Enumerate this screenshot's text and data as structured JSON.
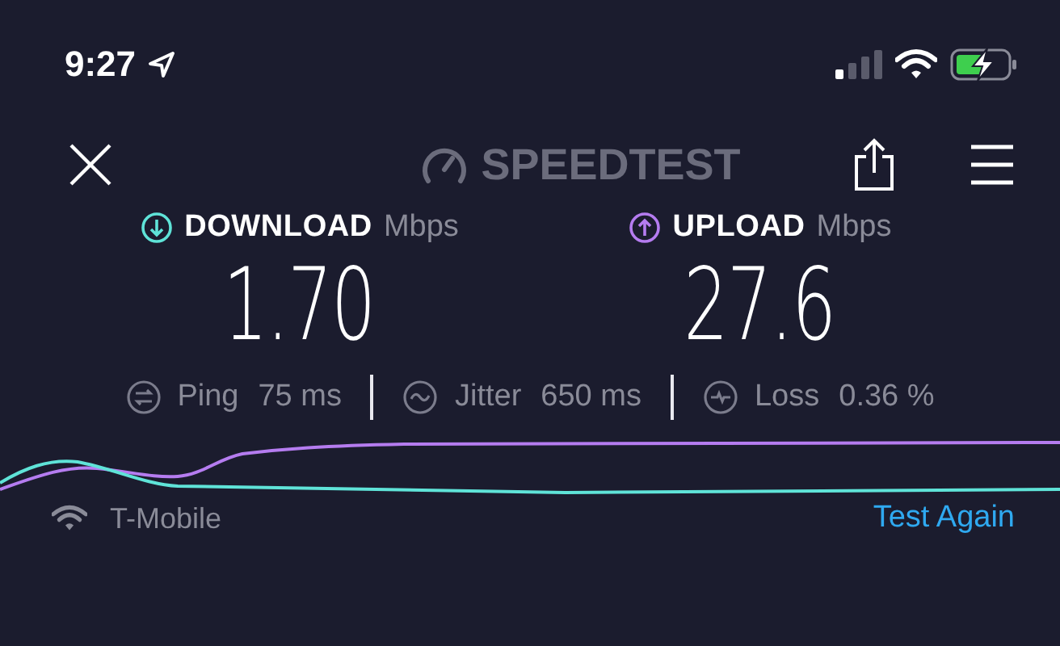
{
  "status_bar": {
    "time": "9:27"
  },
  "toolbar": {
    "logo": "SPEEDTEST"
  },
  "results": [
    {
      "kind": "download",
      "label": "DOWNLOAD",
      "unit": "Mbps",
      "value": "1.70",
      "color": "#5fe3d8"
    },
    {
      "kind": "upload",
      "label": "UPLOAD",
      "unit": "Mbps",
      "value": "27.6",
      "color": "#b57cf0"
    }
  ],
  "stats": [
    {
      "kind": "ping",
      "label": "Ping",
      "value": "75 ms"
    },
    {
      "kind": "jitter",
      "label": "Jitter",
      "value": "650 ms"
    },
    {
      "kind": "loss",
      "label": "Loss",
      "value": "0.36 %"
    }
  ],
  "footer": {
    "network": "T-Mobile",
    "action": "Test Again"
  }
}
